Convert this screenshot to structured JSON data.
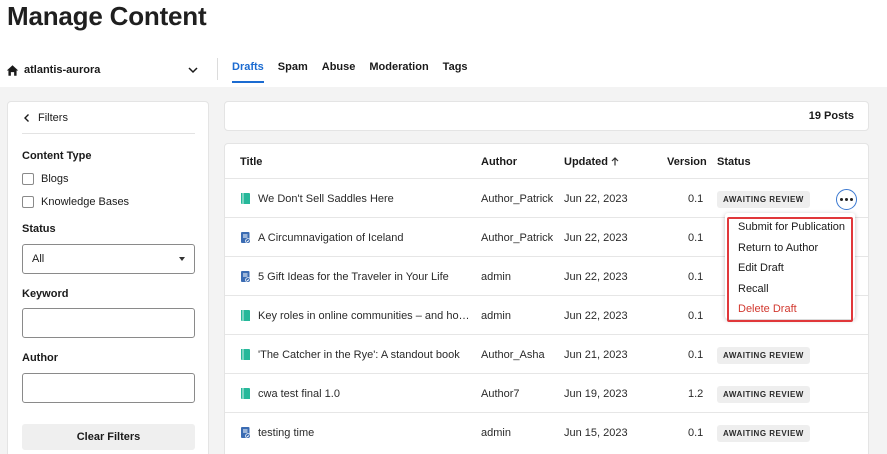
{
  "page": {
    "title": "Manage Content"
  },
  "community": {
    "name": "atlantis-aurora"
  },
  "tabs": [
    {
      "label": "Drafts",
      "active": true
    },
    {
      "label": "Spam",
      "active": false
    },
    {
      "label": "Abuse",
      "active": false
    },
    {
      "label": "Moderation",
      "active": false
    },
    {
      "label": "Tags",
      "active": false
    }
  ],
  "filters": {
    "header": "Filters",
    "content_type_label": "Content Type",
    "content_types": [
      {
        "label": "Blogs",
        "checked": false
      },
      {
        "label": "Knowledge Bases",
        "checked": false
      }
    ],
    "status_label": "Status",
    "status_value": "All",
    "keyword_label": "Keyword",
    "keyword_value": "",
    "author_label": "Author",
    "author_value": "",
    "clear_label": "Clear Filters"
  },
  "posts_count": "19 Posts",
  "table": {
    "columns": {
      "title": "Title",
      "author": "Author",
      "updated": "Updated",
      "version": "Version",
      "status": "Status"
    },
    "rows": [
      {
        "icon": "blog-icon",
        "title": "We Don't Sell Saddles Here",
        "author": "Author_Patrick",
        "updated": "Jun 22, 2023",
        "version": "0.1",
        "status": "AWAITING REVIEW"
      },
      {
        "icon": "knowledge-base-icon",
        "title": "A Circumnavigation of Iceland",
        "author": "Author_Patrick",
        "updated": "Jun 22, 2023",
        "version": "0.1",
        "status": ""
      },
      {
        "icon": "knowledge-base-icon",
        "title": "5 Gift Ideas for the Traveler in Your Life",
        "author": "admin",
        "updated": "Jun 22, 2023",
        "version": "0.1",
        "status": ""
      },
      {
        "icon": "blog-icon",
        "title": "Key roles in online communities – and ho…",
        "author": "admin",
        "updated": "Jun 22, 2023",
        "version": "0.1",
        "status": ""
      },
      {
        "icon": "blog-icon",
        "title": "'The Catcher in the Rye': A standout book",
        "author": "Author_Asha",
        "updated": "Jun 21, 2023",
        "version": "0.1",
        "status": "AWAITING REVIEW"
      },
      {
        "icon": "blog-icon",
        "title": "cwa test final 1.0",
        "author": "Author7",
        "updated": "Jun 19, 2023",
        "version": "1.2",
        "status": "AWAITING REVIEW"
      },
      {
        "icon": "knowledge-base-icon",
        "title": "testing time",
        "author": "admin",
        "updated": "Jun 15, 2023",
        "version": "0.1",
        "status": "AWAITING REVIEW"
      }
    ]
  },
  "action_menu": {
    "items": [
      {
        "label": "Submit for Publication",
        "danger": false
      },
      {
        "label": "Return to Author",
        "danger": false
      },
      {
        "label": "Edit Draft",
        "danger": false
      },
      {
        "label": "Recall",
        "danger": false
      },
      {
        "label": "Delete Draft",
        "danger": true
      }
    ]
  },
  "colors": {
    "accent": "#1b6bd1",
    "danger": "#d2392f",
    "highlight": "#e0373a",
    "blog_icon": "#26b89a",
    "kb_icon": "#3b6cb3"
  }
}
